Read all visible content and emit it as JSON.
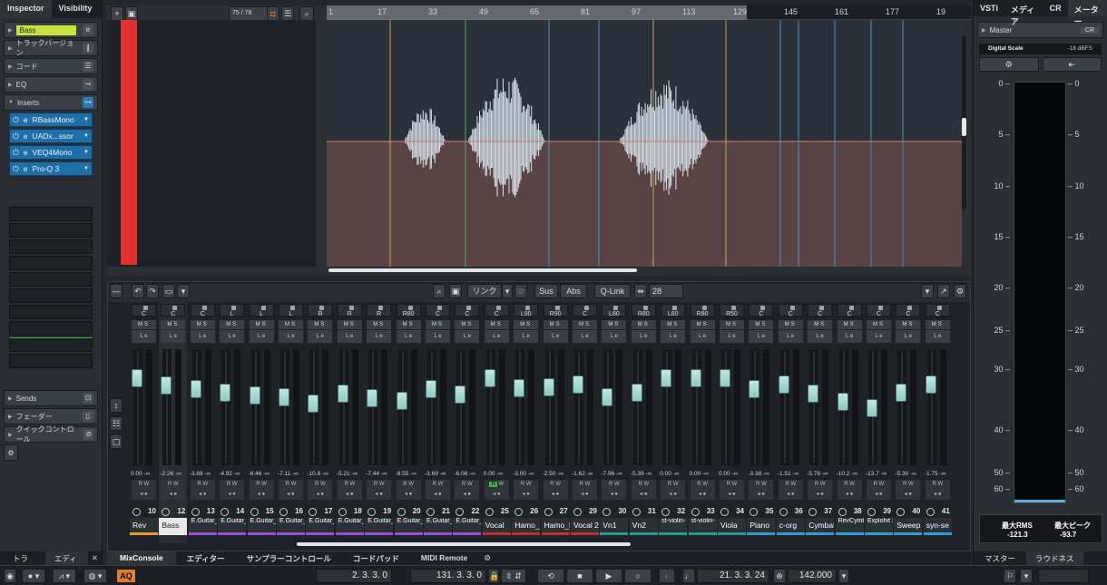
{
  "inspector": {
    "tabs": [
      "Inspector",
      "Visibility"
    ],
    "track_name": "Bass",
    "sections_top": [
      "トラックバージョン",
      "コード",
      "EQ"
    ],
    "inserts_label": "Inserts",
    "inserts": [
      "RBassMono",
      "UADx...ssor",
      "VEQ4Mono",
      "Pro-Q 3"
    ],
    "sections_bottom": [
      "Sends",
      "フェーダー",
      "クイックコントロール"
    ],
    "bottom_tabs": [
      "トラック",
      "エディター"
    ]
  },
  "arrange": {
    "counter": "75 / 78",
    "ruler": [
      "1",
      "17",
      "33",
      "49",
      "65",
      "81",
      "97",
      "113",
      "129",
      "145",
      "161",
      "177",
      "19"
    ]
  },
  "mix": {
    "toolbar": {
      "link": "リンク",
      "sus": "Sus",
      "abs": "Abs",
      "qlink": "Q-Link",
      "count": "28"
    },
    "channels": [
      {
        "pan": "C",
        "val": "0.00",
        "num": "10",
        "name": "Rev",
        "color": "#e0a030",
        "pos": 0.22,
        "act": false
      },
      {
        "pan": "C",
        "val": "-2.26",
        "num": "12",
        "name": "Bass",
        "color": "#e8e8e8",
        "pos": 0.3,
        "act": false
      },
      {
        "pan": "C",
        "val": "-3.68",
        "num": "13",
        "name": "E.Guitar_ Backing...",
        "color": "#9a4fd0",
        "pos": 0.34,
        "act": false
      },
      {
        "pan": "L",
        "val": "-4.92",
        "num": "14",
        "name": "E.Guitar_ Backing...",
        "color": "#9a4fd0",
        "pos": 0.38,
        "act": false
      },
      {
        "pan": "L",
        "val": "-6.46",
        "num": "15",
        "name": "E.Guitar_ Backing...",
        "color": "#9a4fd0",
        "pos": 0.41,
        "act": false
      },
      {
        "pan": "L",
        "val": "-7.11",
        "num": "16",
        "name": "E.Guitar_ Backing...",
        "color": "#9a4fd0",
        "pos": 0.43,
        "act": false
      },
      {
        "pan": "R",
        "val": "-10.8",
        "num": "17",
        "name": "E.Guitar_ Backing...",
        "color": "#9a4fd0",
        "pos": 0.5,
        "act": false
      },
      {
        "pan": "R",
        "val": "-5.21",
        "num": "18",
        "name": "E.Guitar_ Backing...",
        "color": "#9a4fd0",
        "pos": 0.39,
        "act": false
      },
      {
        "pan": "R",
        "val": "-7.44",
        "num": "19",
        "name": "E.Guitar_ Backing...",
        "color": "#9a4fd0",
        "pos": 0.44,
        "act": false
      },
      {
        "pan": "R80",
        "val": "-8.55",
        "num": "20",
        "name": "E.Guitar_ Backing...",
        "color": "#9a4fd0",
        "pos": 0.47,
        "act": false
      },
      {
        "pan": "C",
        "val": "-3.69",
        "num": "21",
        "name": "E.Guitar_ Solo",
        "color": "#9a4fd0",
        "pos": 0.34,
        "act": false
      },
      {
        "pan": "C",
        "val": "-6.08",
        "num": "22",
        "name": "E.Guitar_ Solo2_Ha...",
        "color": "#9a4fd0",
        "pos": 0.4,
        "act": false
      },
      {
        "pan": "C",
        "val": "0.00",
        "num": "25",
        "name": "Vocal",
        "color": "#c03030",
        "pos": 0.22,
        "act": true
      },
      {
        "pan": "L90",
        "val": "-3.00",
        "num": "26",
        "name": "Hamo_L",
        "color": "#c03030",
        "pos": 0.33,
        "act": false
      },
      {
        "pan": "R90",
        "val": "-2.50",
        "num": "27",
        "name": "Hamo_R",
        "color": "#c03030",
        "pos": 0.32,
        "act": false
      },
      {
        "pan": "C",
        "val": "-1.62",
        "num": "29",
        "name": "Vocal 2",
        "color": "#c03030",
        "pos": 0.29,
        "act": false
      },
      {
        "pan": "L80",
        "val": "-7.96",
        "num": "30",
        "name": "Vn1",
        "color": "#20a090",
        "pos": 0.43,
        "act": false
      },
      {
        "pan": "R80",
        "val": "-5.39",
        "num": "31",
        "name": "Vn2",
        "color": "#20a090",
        "pos": 0.38,
        "act": false
      },
      {
        "pan": "L80",
        "val": "0.00",
        "num": "32",
        "name": "st-violin- 1st",
        "color": "#20a090",
        "pos": 0.22,
        "act": false
      },
      {
        "pan": "R80",
        "val": "0.00",
        "num": "33",
        "name": "st-violin- 2nd",
        "color": "#20a090",
        "pos": 0.22,
        "act": false
      },
      {
        "pan": "R50",
        "val": "0.00",
        "num": "34",
        "name": "Viola",
        "color": "#20a090",
        "pos": 0.22,
        "act": false
      },
      {
        "pan": "C",
        "val": "-3.38",
        "num": "35",
        "name": "Piano",
        "color": "#2aa0d0",
        "pos": 0.34,
        "act": false
      },
      {
        "pan": "C",
        "val": "-1.51",
        "num": "36",
        "name": "c-org",
        "color": "#2aa0d0",
        "pos": 0.29,
        "act": false
      },
      {
        "pan": "C",
        "val": "-5.78",
        "num": "37",
        "name": "Cymbal",
        "color": "#2aa0d0",
        "pos": 0.39,
        "act": false
      },
      {
        "pan": "C",
        "val": "-10.2",
        "num": "38",
        "name": "RevCymb al",
        "color": "#2aa0d0",
        "pos": 0.48,
        "act": false
      },
      {
        "pan": "C",
        "val": "-13.7",
        "num": "39",
        "name": "Explohit 38",
        "color": "#2aa0d0",
        "pos": 0.55,
        "act": false
      },
      {
        "pan": "C",
        "val": "-5.30",
        "num": "40",
        "name": "Sweep",
        "color": "#2aa0d0",
        "pos": 0.38,
        "act": false
      },
      {
        "pan": "C",
        "val": "-1.75",
        "num": "41",
        "name": "syn-se",
        "color": "#2aa0d0",
        "pos": 0.29,
        "act": false
      }
    ],
    "tabs": [
      "MixConsole",
      "エディター",
      "サンプラーコントロール",
      "コードパッド",
      "MIDI Remote"
    ]
  },
  "meter": {
    "tabs": [
      "VSTi",
      "メディア",
      "CR",
      "メーター"
    ],
    "master": "Master",
    "cr": "CR",
    "scale": "Digital Scale",
    "dbfs": "-18 dBFS",
    "ticks": [
      "0",
      "5",
      "10",
      "15",
      "20",
      "25",
      "30",
      "40",
      "50",
      "60"
    ],
    "rms_label": "最大RMS",
    "rms": "-121.3",
    "peak_label": "最大ピーク",
    "peak": "-93.7",
    "bottom_tabs": [
      "マスター",
      "ラウドネス"
    ]
  },
  "transport": {
    "pos1": "2. 3. 3.   0",
    "pos2": "131. 3. 3.   0",
    "pos3": "21. 3. 3. 24",
    "tempo": "142.000",
    "aq": "AQ"
  }
}
